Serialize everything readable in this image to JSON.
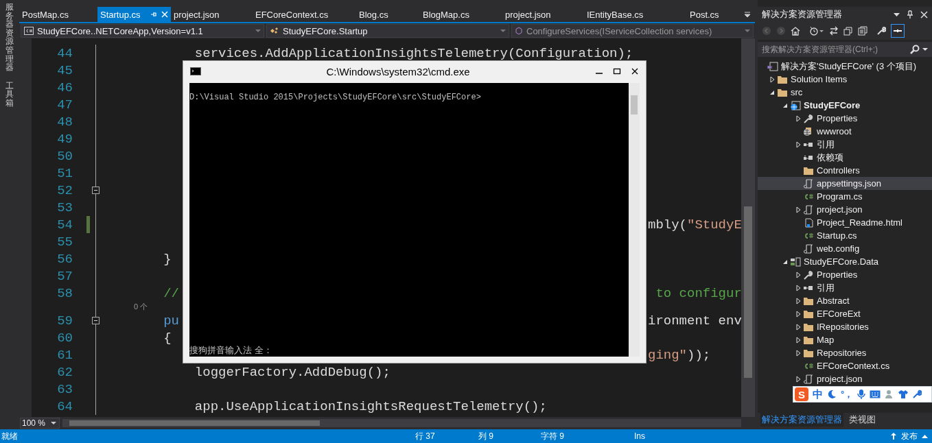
{
  "side_tabs": [
    {
      "label": "服务器资源管理器"
    },
    {
      "label": "工具箱"
    }
  ],
  "tabs": [
    {
      "label": "PostMap.cs",
      "selected": false
    },
    {
      "label": "Startup.cs",
      "selected": true
    },
    {
      "label": "project.json",
      "selected": false
    },
    {
      "label": "EFCoreContext.cs",
      "selected": false
    },
    {
      "label": "Blog.cs",
      "selected": false
    },
    {
      "label": "BlogMap.cs",
      "selected": false
    },
    {
      "label": "project.json",
      "selected": false
    },
    {
      "label": "IEntityBase.cs",
      "selected": false
    },
    {
      "label": "Post.cs",
      "selected": false
    }
  ],
  "nav": [
    {
      "label": "StudyEFCore..NETCoreApp,Version=v1.1",
      "kind": "project",
      "disabled": false
    },
    {
      "label": "StudyEFCore.Startup",
      "kind": "class",
      "disabled": false
    },
    {
      "label": "ConfigureServices(IServiceCollection services)",
      "kind": "method",
      "disabled": true
    }
  ],
  "code_lines": [
    {
      "number": "44",
      "left": [
        {
          "t": "            services.AddApplicationInsightsTelemetry(Configuration);",
          "kind": "plain"
        }
      ]
    },
    {
      "number": "45"
    },
    {
      "number": "46"
    },
    {
      "number": "47"
    },
    {
      "number": "48"
    },
    {
      "number": "49"
    },
    {
      "number": "50"
    },
    {
      "number": "51"
    },
    {
      "number": "52",
      "collapsible": true
    },
    {
      "number": "53"
    },
    {
      "number": "54",
      "changed": true,
      "right": [
        {
          "t": "mbly(",
          "kind": "plain"
        },
        {
          "t": "\"StudyE",
          "kind": "string"
        }
      ]
    },
    {
      "number": "55"
    },
    {
      "number": "56",
      "left": [
        {
          "t": "        }",
          "kind": "plain"
        }
      ]
    },
    {
      "number": "57"
    },
    {
      "number": "58",
      "left": [
        {
          "t": "        //",
          "kind": "comment"
        }
      ],
      "right": [
        {
          "t": " to configur",
          "kind": "comment"
        }
      ]
    },
    {
      "number": "59",
      "codelens": "0 个",
      "collapsible": true,
      "left": [
        {
          "t": "        pu",
          "kind": "keyword"
        }
      ],
      "right": [
        {
          "t": "ironment env",
          "kind": "plain"
        }
      ]
    },
    {
      "number": "60",
      "left": [
        {
          "t": "        {",
          "kind": "plain"
        }
      ]
    },
    {
      "number": "61",
      "right": [
        {
          "t": "ging\"",
          "kind": "string"
        },
        {
          "t": "));",
          "kind": "plain"
        }
      ]
    },
    {
      "number": "62",
      "left": [
        {
          "t": "            loggerFactory.AddDebug();",
          "kind": "plain"
        }
      ]
    },
    {
      "number": "63"
    },
    {
      "number": "64",
      "left": [
        {
          "t": "            app.UseApplicationInsightsRequestTelemetry();",
          "kind": "plain"
        }
      ]
    }
  ],
  "zoom": "100 %",
  "explorer": {
    "title": "解决方案资源管理器",
    "search": {
      "placeholder": "搜索解决方案资源管理器(Ctrl+;)"
    },
    "tree": [
      {
        "label": "解决方案'StudyEFCore' (3 个项目)",
        "kind": "solution",
        "selected": false,
        "children": [
          {
            "label": "Solution Items",
            "kind": "folder",
            "selected": false,
            "expanded": false
          },
          {
            "label": "src",
            "kind": "folder",
            "selected": false,
            "expanded": true,
            "children": [
              {
                "label": "StudyEFCore",
                "kind": "web-project",
                "selected": false,
                "expanded": true,
                "startup": true,
                "children": [
                  {
                    "label": "Properties",
                    "kind": "wrench",
                    "selected": false,
                    "expanded": false
                  },
                  {
                    "label": "wwwroot",
                    "kind": "globe",
                    "selected": false
                  },
                  {
                    "label": "引用",
                    "kind": "references",
                    "selected": false,
                    "expanded": false
                  },
                  {
                    "label": "依赖项",
                    "kind": "dependencies",
                    "selected": false
                  },
                  {
                    "label": "Controllers",
                    "kind": "folder",
                    "selected": false
                  },
                  {
                    "label": "appsettings.json",
                    "kind": "json",
                    "selected": true
                  },
                  {
                    "label": "Program.cs",
                    "kind": "cs",
                    "selected": false
                  },
                  {
                    "label": "project.json",
                    "kind": "json",
                    "selected": false,
                    "expanded": false
                  },
                  {
                    "label": "Project_Readme.html",
                    "kind": "html",
                    "selected": false
                  },
                  {
                    "label": "Startup.cs",
                    "kind": "cs",
                    "selected": false
                  },
                  {
                    "label": "web.config",
                    "kind": "config",
                    "selected": false
                  }
                ]
              },
              {
                "label": "StudyEFCore.Data",
                "kind": "lib-project",
                "selected": false,
                "expanded": true,
                "children": [
                  {
                    "label": "Properties",
                    "kind": "wrench",
                    "selected": false,
                    "expanded": false
                  },
                  {
                    "label": "引用",
                    "kind": "references",
                    "selected": false,
                    "expanded": false
                  },
                  {
                    "label": "Abstract",
                    "kind": "folder",
                    "selected": false,
                    "expanded": false
                  },
                  {
                    "label": "EFCoreExt",
                    "kind": "folder",
                    "selected": false,
                    "expanded": false
                  },
                  {
                    "label": "IRepositories",
                    "kind": "folder",
                    "selected": false,
                    "expanded": false
                  },
                  {
                    "label": "Map",
                    "kind": "folder",
                    "selected": false,
                    "expanded": false
                  },
                  {
                    "label": "Repositories",
                    "kind": "folder",
                    "selected": false,
                    "expanded": false
                  },
                  {
                    "label": "EFCoreContext.cs",
                    "kind": "cs",
                    "selected": false
                  },
                  {
                    "label": "project.json",
                    "kind": "json",
                    "selected": false,
                    "expanded": false
                  }
                ]
              }
            ]
          }
        ]
      }
    ],
    "bottom_tabs": [
      {
        "label": "解决方案资源管理器",
        "selected": true
      },
      {
        "label": "类视图",
        "selected": false
      }
    ]
  },
  "status_bar": {
    "state": "就绪",
    "line": "行 37",
    "column": "列 9",
    "char": "字符 9",
    "mode": "Ins",
    "publish": "发布"
  },
  "console": {
    "title": "C:\\Windows\\system32\\cmd.exe",
    "prompt": "D:\\Visual Studio 2015\\Projects\\StudyEFCore\\src\\StudyEFCore>",
    "ime_line": "搜狗拼音输入法 全："
  },
  "ime_bar": {
    "logo": "S",
    "mode": "中",
    "punctuation": "°，"
  }
}
